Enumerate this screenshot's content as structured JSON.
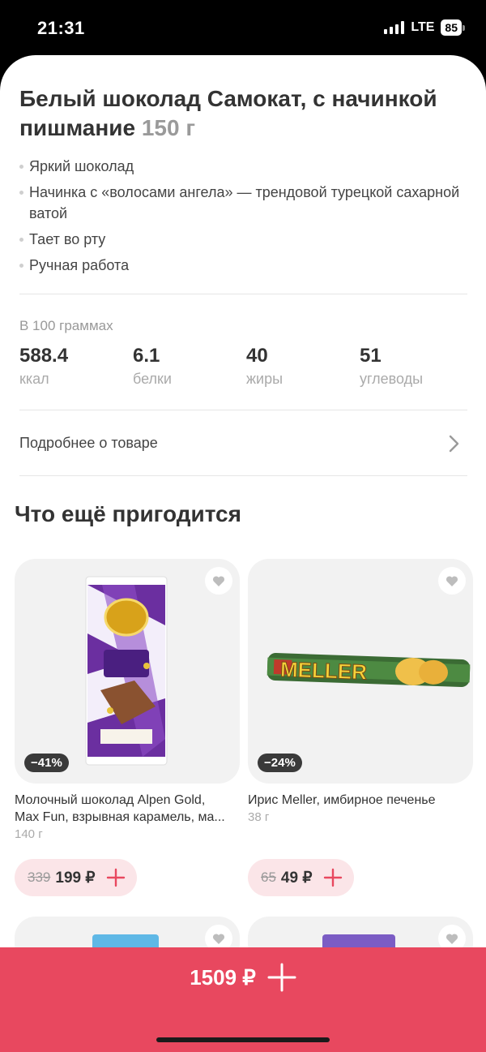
{
  "status": {
    "time": "21:31",
    "network": "LTE",
    "battery": "85"
  },
  "product": {
    "title": "Белый шоколад Самокат, с начинкой пишмание",
    "weight": "150 г",
    "features": [
      "Яркий шоколад",
      "Начинка с «волосами ангела» — трендовой турецкой сахарной ватой",
      "Тает во рту",
      "Ручная работа"
    ]
  },
  "nutrition": {
    "label": "В 100 граммах",
    "items": [
      {
        "value": "588.4",
        "unit": "ккал"
      },
      {
        "value": "6.1",
        "unit": "белки"
      },
      {
        "value": "40",
        "unit": "жиры"
      },
      {
        "value": "51",
        "unit": "углеводы"
      }
    ]
  },
  "details_link": "Подробнее о товаре",
  "recommend": {
    "title": "Что ещё пригодится",
    "cards": [
      {
        "image": "alpen-gold-chocolate-image",
        "discount": "−41%",
        "name_line1": "Молочный шоколад Alpen Gold,",
        "name_line2": "Max Fun, взрывная карамель, ма...",
        "weight": "140 г",
        "old_price": "339",
        "price": "199 ₽"
      },
      {
        "image": "meller-toffee-image",
        "discount": "−24%",
        "name_line1": "Ирис Meller, имбирное печенье",
        "name_line2": "",
        "weight": "38 г",
        "old_price": "65",
        "price": "49 ₽"
      }
    ]
  },
  "cart": {
    "total": "1509 ₽"
  },
  "colors": {
    "accent": "#e8485f",
    "price_bg": "#fbe5e8",
    "badge": "#3a3a3a"
  }
}
